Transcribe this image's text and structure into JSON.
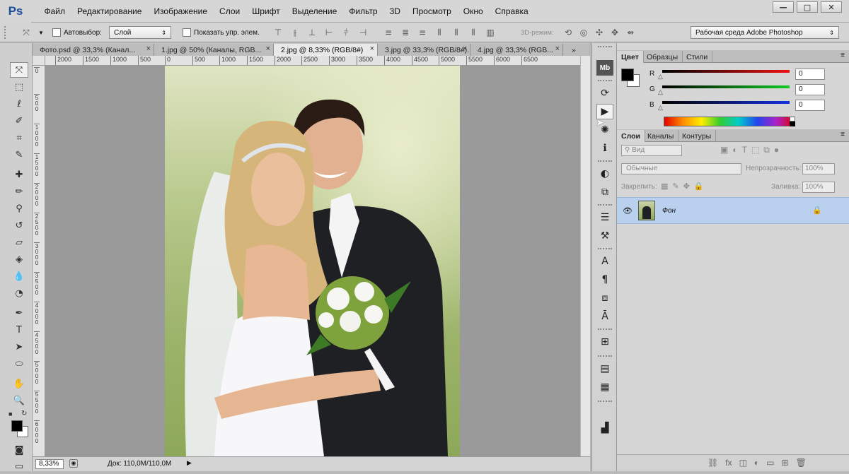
{
  "app": {
    "logo": "Ps"
  },
  "menu": [
    "Файл",
    "Редактирование",
    "Изображение",
    "Слои",
    "Шрифт",
    "Выделение",
    "Фильтр",
    "3D",
    "Просмотр",
    "Окно",
    "Справка"
  ],
  "window_controls": {
    "minimize": "—",
    "maximize": "□",
    "close": "✕"
  },
  "options": {
    "auto_select_label": "Автовыбор:",
    "auto_select_value": "Слой",
    "show_transform_label": "Показать упр. элем.",
    "mode_3d_label": "3D-режим:",
    "workspace": "Рабочая среда Adobe Photoshop"
  },
  "tabs": [
    {
      "label": "Фото.psd @ 33,3% (Канал..."
    },
    {
      "label": "1.jpg @ 50% (Каналы, RGB..."
    },
    {
      "label": "2.jpg @ 8,33% (RGB/8#)"
    },
    {
      "label": "3.jpg @ 33,3% (RGB/8#)..."
    },
    {
      "label": "4.jpg @ 33,3% (RGB..."
    }
  ],
  "ruler_h": [
    "2000",
    "1500",
    "1000",
    "500",
    "0",
    "500",
    "1000",
    "1500",
    "2000",
    "2500",
    "3000",
    "3500",
    "4000",
    "4500",
    "5000",
    "5500",
    "6000",
    "6500"
  ],
  "ruler_v": [
    "0",
    "5\n0\n0",
    "1\n0\n0\n0",
    "1\n5\n0\n0",
    "2\n0\n0\n0",
    "2\n5\n0\n0",
    "3\n0\n0\n0",
    "3\n5\n0\n0",
    "4\n0\n0\n0",
    "4\n5\n0\n0",
    "5\n0\n0\n0",
    "5\n5\n0\n0",
    "6\n0\n0\n0"
  ],
  "status": {
    "zoom": "8,33%",
    "doc": "Док: 110,0M/110,0M"
  },
  "color_panel": {
    "tabs": [
      "Цвет",
      "Образцы",
      "Стили"
    ],
    "channels": [
      {
        "label": "R",
        "value": "0",
        "color": "#ee1111"
      },
      {
        "label": "G",
        "value": "0",
        "color": "#11cc22"
      },
      {
        "label": "B",
        "value": "0",
        "color": "#1133dd"
      }
    ]
  },
  "layers_panel": {
    "tabs": [
      "Слои",
      "Каналы",
      "Контуры"
    ],
    "filter_label": "Вид",
    "blend_mode": "Обычные",
    "opacity_label": "Непрозрачность:",
    "opacity_value": "100%",
    "lock_label": "Закрепить:",
    "fill_label": "Заливка:",
    "fill_value": "100%",
    "layers": [
      {
        "name": "Фон",
        "visible": true,
        "locked": true
      }
    ]
  }
}
